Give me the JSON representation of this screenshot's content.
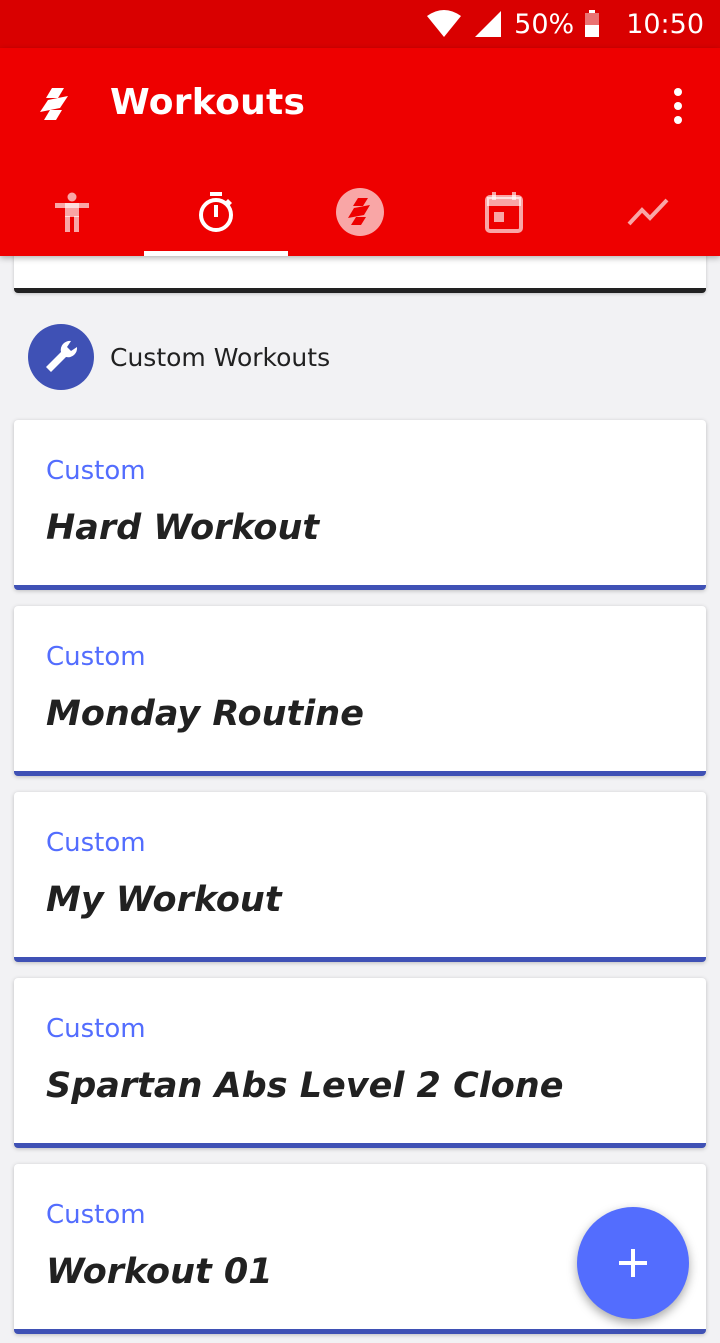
{
  "status_bar": {
    "battery": "50%",
    "time": "10:50"
  },
  "app_bar": {
    "title": "Workouts"
  },
  "tabs": [
    {
      "name": "exercises",
      "icon": "person-icon"
    },
    {
      "name": "timer",
      "icon": "stopwatch-icon",
      "active": true
    },
    {
      "name": "spartan",
      "icon": "spartan-logo-icon"
    },
    {
      "name": "calendar",
      "icon": "calendar-icon"
    },
    {
      "name": "progress",
      "icon": "trending-icon"
    }
  ],
  "section": {
    "title": "Custom Workouts",
    "icon": "wrench-icon"
  },
  "workouts": [
    {
      "tag": "Custom",
      "title": "Hard Workout"
    },
    {
      "tag": "Custom",
      "title": "Monday Routine"
    },
    {
      "tag": "Custom",
      "title": "My Workout"
    },
    {
      "tag": "Custom",
      "title": "Spartan Abs Level 2 Clone"
    },
    {
      "tag": "Custom",
      "title": "Workout 01"
    }
  ],
  "fab": {
    "icon": "plus-icon"
  },
  "colors": {
    "app_bar": "#ee0000",
    "status_bar": "#d90000",
    "accent": "#536dfe",
    "card_border": "#3f51b5"
  }
}
